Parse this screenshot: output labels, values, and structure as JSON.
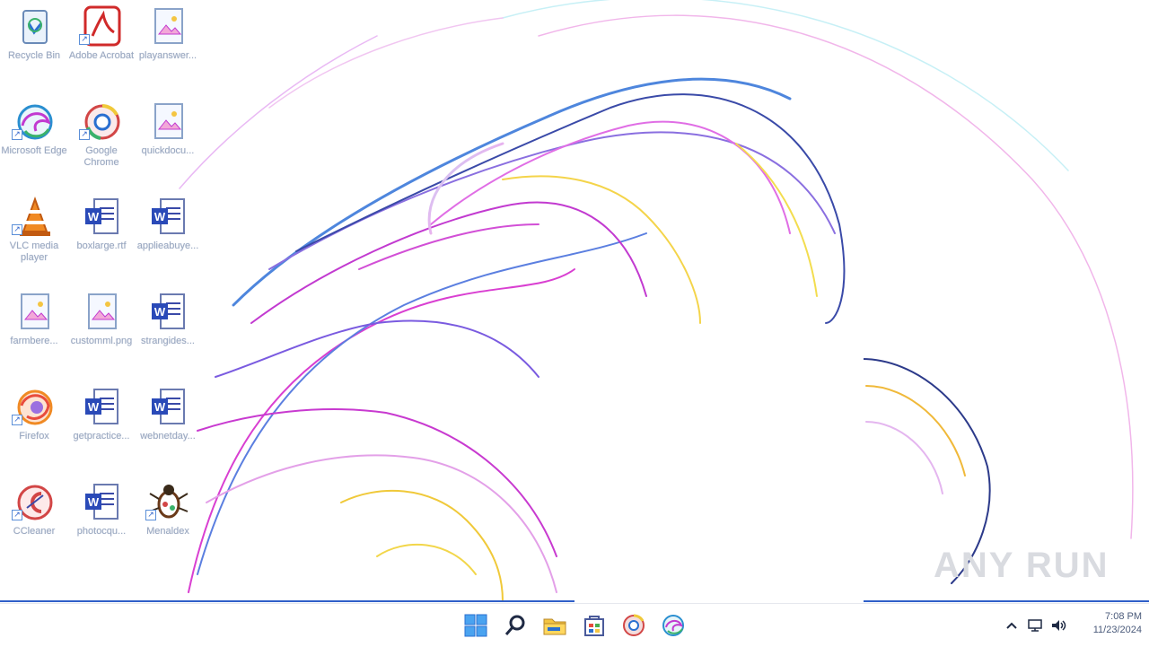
{
  "desktop": {
    "icons": [
      {
        "label": "Recycle Bin",
        "icon": "recycle-bin-icon"
      },
      {
        "label": "Adobe Acrobat",
        "icon": "adobe-acrobat-icon"
      },
      {
        "label": "playanswer...",
        "icon": "image-file-icon"
      },
      {
        "label": "Microsoft Edge",
        "icon": "edge-icon"
      },
      {
        "label": "Google Chrome",
        "icon": "chrome-icon"
      },
      {
        "label": "quickdocu...",
        "icon": "image-file-icon"
      },
      {
        "label": "VLC media player",
        "icon": "vlc-icon"
      },
      {
        "label": "boxlarge.rtf",
        "icon": "word-doc-icon"
      },
      {
        "label": "applieabuye...",
        "icon": "word-doc-icon"
      },
      {
        "label": "farmbere...",
        "icon": "image-file-icon"
      },
      {
        "label": "customml.png",
        "icon": "image-file-icon"
      },
      {
        "label": "strangides...",
        "icon": "word-doc-icon"
      },
      {
        "label": "Firefox",
        "icon": "firefox-icon"
      },
      {
        "label": "getpractice...",
        "icon": "word-doc-icon"
      },
      {
        "label": "webnetday...",
        "icon": "word-doc-icon"
      },
      {
        "label": "CCleaner",
        "icon": "ccleaner-icon"
      },
      {
        "label": "photocqu...",
        "icon": "word-doc-icon"
      },
      {
        "label": "Menaldex",
        "icon": "bug-app-icon"
      }
    ]
  },
  "taskbar": {
    "buttons": [
      {
        "name": "start",
        "icon": "windows-start-icon"
      },
      {
        "name": "search",
        "icon": "search-icon"
      },
      {
        "name": "file-explorer",
        "icon": "folder-icon"
      },
      {
        "name": "store",
        "icon": "store-icon"
      },
      {
        "name": "chrome",
        "icon": "chrome-icon"
      },
      {
        "name": "edge",
        "icon": "edge-icon"
      }
    ],
    "tray": {
      "time": "7:08 PM",
      "date": "11/23/2024",
      "icons": [
        "chevron-up-icon",
        "network-icon",
        "volume-icon"
      ]
    }
  },
  "watermark": {
    "text": "ANY RUN"
  },
  "colors": {
    "taskbar": "#ffffff",
    "label_text": "#9aa8c0",
    "accent": "#3b6fd8"
  }
}
